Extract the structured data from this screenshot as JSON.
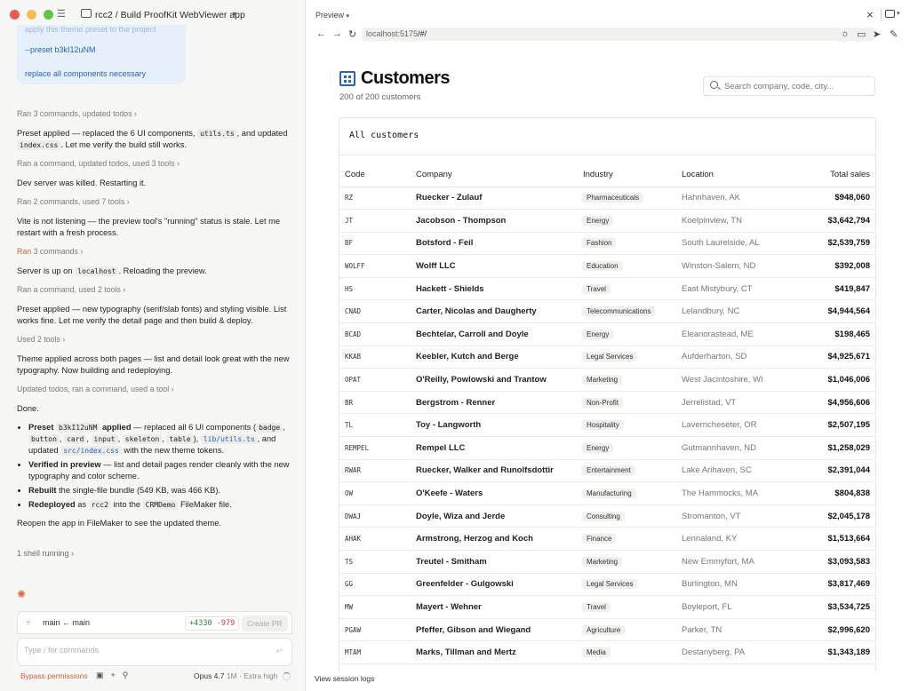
{
  "window": {
    "breadcrumb": "rcc2 / Build ProofKit WebViewer app"
  },
  "user_message": {
    "faded_line": "apply this theme preset to the project",
    "line1": "--preset b3kI12uNM",
    "line2": "replace all components necessary"
  },
  "chat": {
    "t1": "Ran 3 commands, updated todos",
    "m1a": "Preset applied — replaced the 6 UI components, ",
    "m1_code1": "utils.ts",
    "m1b": ", and updated ",
    "m1_code2": "index.css",
    "m1c": ". Let me verify the build still works.",
    "t2": "Ran a command, updated todos, used 3 tools",
    "m2": "Dev server was killed. Restarting it.",
    "t3": "Ran 2 commands, used 7 tools",
    "m3": "Vite is not listening — the preview tool's \"running\" status is stale. Let me restart with a fresh process.",
    "t4_ran": "Ran",
    "t4_rest": " 3 commands",
    "m4a": "Server is up on ",
    "m4_code": "localhost",
    "m4b": ". Reloading the preview.",
    "t5": "Ran a command, used 2 tools",
    "m5": "Preset applied — new typography (serif/slab fonts) and styling visible. List works fine. Let me verify the detail page and then build & deploy.",
    "t6": "Used 2 tools",
    "m6": "Theme applied across both pages — list and detail look great with the new typography. Now building and redeploying.",
    "t7": "Updated todos, ran a command, used a tool",
    "m7": "Done.",
    "b1_bold": "Preset",
    "b1_code1": "b3kI12uNM",
    "b1_bold2": " applied",
    "b1_text1": " — replaced all 6 UI components (",
    "b1_badge": "badge",
    "b1_sep1": ", ",
    "b1_button": "button",
    "b1_sep2": ", ",
    "b1_card": "card",
    "b1_sep3": ", ",
    "b1_input": "input",
    "b1_sep4": ", ",
    "b1_skeleton": "skeleton",
    "b1_sep5": ", ",
    "b1_table": "table",
    "b1_text2": "), ",
    "b1_utils": "lib/utils.ts",
    "b1_text3": ", and updated ",
    "b1_css": "src/index.css",
    "b1_text4": " with the new theme tokens.",
    "b2_bold": "Verified in preview",
    "b2_text": " — list and detail pages render cleanly with the new typography and color scheme.",
    "b3_bold": "Rebuilt",
    "b3_text": " the single-file bundle (549 KB, was 466 KB).",
    "b4_bold": "Redeployed",
    "b4_text1": " as ",
    "b4_code1": "rcc2",
    "b4_text2": " into the ",
    "b4_code2": "CRMDemo",
    "b4_text3": " FileMaker file.",
    "m8": "Reopen the app in FileMaker to see the updated theme.",
    "caret": "›"
  },
  "shell_status": "1 shell running ›",
  "branch": {
    "text": "main ← main",
    "additions": "+4330",
    "deletions": "-979",
    "create_pr": "Create PR"
  },
  "composer": {
    "placeholder": "Type / for commands"
  },
  "bottom": {
    "permissions": "Bypass permissions",
    "model": "Opus 4.7",
    "context": " 1M · Extra high"
  },
  "preview": {
    "title": "Preview",
    "url_host": "localhost:5175",
    "url_path": "/#/",
    "session_logs": "View session logs"
  },
  "app": {
    "title": "Customers",
    "count": "200 of 200 customers",
    "search_placeholder": "Search company, code, city...",
    "card_title": "All customers",
    "columns": [
      "Code",
      "Company",
      "Industry",
      "Location",
      "Total sales"
    ],
    "rows": [
      {
        "code": "RZ",
        "company": "Ruecker - Zulauf",
        "industry": "Pharmaceuticals",
        "location": "Hahnhaven, AK",
        "sales": "$948,060"
      },
      {
        "code": "JT",
        "company": "Jacobson - Thompson",
        "industry": "Energy",
        "location": "Koelpinview, TN",
        "sales": "$3,642,794"
      },
      {
        "code": "BF",
        "company": "Botsford - Feil",
        "industry": "Fashion",
        "location": "South Laurelside, AL",
        "sales": "$2,539,759"
      },
      {
        "code": "WOLFF",
        "company": "Wolff LLC",
        "industry": "Education",
        "location": "Winston-Salem, ND",
        "sales": "$392,008"
      },
      {
        "code": "HS",
        "company": "Hackett - Shields",
        "industry": "Travel",
        "location": "East Mistybury, CT",
        "sales": "$419,847"
      },
      {
        "code": "CNAD",
        "company": "Carter, Nicolas and Daugherty",
        "industry": "Telecommunications",
        "location": "Lelandbury, NC",
        "sales": "$4,944,564"
      },
      {
        "code": "BCAD",
        "company": "Bechtelar, Carroll and Doyle",
        "industry": "Energy",
        "location": "Eleanorastead, ME",
        "sales": "$198,465"
      },
      {
        "code": "KKAB",
        "company": "Keebler, Kutch and Berge",
        "industry": "Legal Services",
        "location": "Aufderharton, SD",
        "sales": "$4,925,671"
      },
      {
        "code": "OPAT",
        "company": "O'Reilly, Powlowski and Trantow",
        "industry": "Marketing",
        "location": "West Jacintoshire, WI",
        "sales": "$1,046,006"
      },
      {
        "code": "BR",
        "company": "Bergstrom - Renner",
        "industry": "Non-Profit",
        "location": "Jerrelistad, VT",
        "sales": "$4,956,606"
      },
      {
        "code": "TL",
        "company": "Toy - Langworth",
        "industry": "Hospitality",
        "location": "Laverncheseter, OR",
        "sales": "$2,507,195"
      },
      {
        "code": "REMPEL",
        "company": "Rempel LLC",
        "industry": "Energy",
        "location": "Gutmannhaven, ND",
        "sales": "$1,258,029"
      },
      {
        "code": "RWAR",
        "company": "Ruecker, Walker and Runolfsdottir",
        "industry": "Entertainment",
        "location": "Lake Arihaven, SC",
        "sales": "$2,391,044"
      },
      {
        "code": "OW",
        "company": "O'Keefe - Waters",
        "industry": "Manufacturing",
        "location": "The Hammocks, MA",
        "sales": "$804,838"
      },
      {
        "code": "DWAJ",
        "company": "Doyle, Wiza and Jerde",
        "industry": "Consulting",
        "location": "Stromanton, VT",
        "sales": "$2,045,178"
      },
      {
        "code": "AHAK",
        "company": "Armstrong, Herzog and Koch",
        "industry": "Finance",
        "location": "Lennaland, KY",
        "sales": "$1,513,664"
      },
      {
        "code": "TS",
        "company": "Treutel - Smitham",
        "industry": "Marketing",
        "location": "New Emmyfort, MA",
        "sales": "$3,093,583"
      },
      {
        "code": "GG",
        "company": "Greenfelder - Gulgowski",
        "industry": "Legal Services",
        "location": "Burlington, MN",
        "sales": "$3,817,469"
      },
      {
        "code": "MW",
        "company": "Mayert - Wehner",
        "industry": "Travel",
        "location": "Boyleport, FL",
        "sales": "$3,534,725"
      },
      {
        "code": "PGAW",
        "company": "Pfeffer, Gibson and Wiegand",
        "industry": "Agriculture",
        "location": "Parker, TN",
        "sales": "$2,996,620"
      },
      {
        "code": "MTAM",
        "company": "Marks, Tillman and Mertz",
        "industry": "Media",
        "location": "Destanyberg, PA",
        "sales": "$1,343,189"
      }
    ]
  },
  "colors": {
    "accent": "#2a64b4",
    "claude_orange": "#c4633b"
  }
}
